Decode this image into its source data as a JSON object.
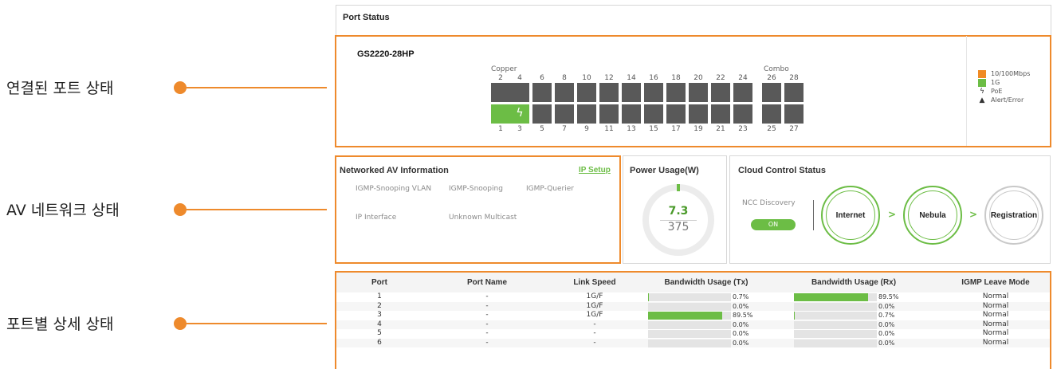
{
  "callouts": [
    {
      "label": "연결된 포트 상태"
    },
    {
      "label": "AV 네트워크 상태"
    },
    {
      "label": "포트별 상세 상태"
    }
  ],
  "port_status": {
    "title": "Port Status",
    "model": "GS2220-28HP",
    "copper_label": "Copper",
    "combo_label": "Combo",
    "copper_top_numbers": [
      "2",
      "4",
      "6",
      "8",
      "10",
      "12",
      "14",
      "16",
      "18",
      "20",
      "22",
      "24"
    ],
    "copper_bottom_numbers": [
      "1",
      "3",
      "5",
      "7",
      "9",
      "11",
      "13",
      "15",
      "17",
      "19",
      "21",
      "23"
    ],
    "combo_top_numbers": [
      "26",
      "28"
    ],
    "combo_bottom_numbers": [
      "25",
      "27"
    ],
    "legend": [
      {
        "label": "10/100Mbps",
        "color": "#f08a24"
      },
      {
        "label": "1G",
        "color": "#6cbd45"
      },
      {
        "label": "PoE",
        "icon": "lightning-icon"
      },
      {
        "label": "Alert/Error",
        "icon": "warning-triangle-icon"
      }
    ]
  },
  "av_info": {
    "title": "Networked AV Information",
    "ip_setup": "IP Setup",
    "items": [
      "IGMP-Snooping VLAN",
      "IGMP-Snooping",
      "IGMP-Querier",
      "IP Interface",
      "Unknown Multicast"
    ]
  },
  "power": {
    "title": "Power Usage(W)",
    "value": "7.3",
    "max": "375"
  },
  "cloud": {
    "title": "Cloud Control Status",
    "ncc_label": "NCC Discovery",
    "ncc_state": "ON",
    "steps": [
      "Internet",
      "Nebula",
      "Registration"
    ],
    "arrow": ">"
  },
  "table": {
    "headers": [
      "Port",
      "Port Name",
      "Link Speed",
      "Bandwidth Usage (Tx)",
      "Bandwidth Usage (Rx)",
      "IGMP Leave Mode"
    ],
    "rows": [
      {
        "port": "1",
        "name": "-",
        "speed": "1G/F",
        "tx": "0.7%",
        "tx_val": 0.7,
        "rx": "89.5%",
        "rx_val": 89.5,
        "mode": "Normal"
      },
      {
        "port": "2",
        "name": "-",
        "speed": "1G/F",
        "tx": "0.0%",
        "tx_val": 0.0,
        "rx": "0.0%",
        "rx_val": 0.0,
        "mode": "Normal"
      },
      {
        "port": "3",
        "name": "-",
        "speed": "1G/F",
        "tx": "89.5%",
        "tx_val": 89.5,
        "rx": "0.7%",
        "rx_val": 0.7,
        "mode": "Normal"
      },
      {
        "port": "4",
        "name": "-",
        "speed": "-",
        "tx": "0.0%",
        "tx_val": 0.0,
        "rx": "0.0%",
        "rx_val": 0.0,
        "mode": "Normal"
      },
      {
        "port": "5",
        "name": "-",
        "speed": "-",
        "tx": "0.0%",
        "tx_val": 0.0,
        "rx": "0.0%",
        "rx_val": 0.0,
        "mode": "Normal"
      },
      {
        "port": "6",
        "name": "-",
        "speed": "-",
        "tx": "0.0%",
        "tx_val": 0.0,
        "rx": "0.0%",
        "rx_val": 0.0,
        "mode": "Normal"
      }
    ]
  },
  "colors": {
    "accent": "#ee8a2c",
    "green": "#6cbd45",
    "port_off": "#595959"
  }
}
